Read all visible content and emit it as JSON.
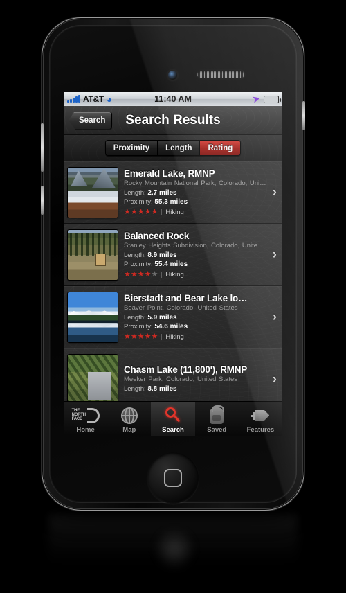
{
  "status_bar": {
    "carrier": "AT&T",
    "time": "11:40 AM",
    "signal_icon": "signal-bars-icon",
    "wifi_icon": "wifi-icon",
    "location_icon": "location-arrow-icon",
    "battery_icon": "battery-icon"
  },
  "nav": {
    "back_label": "Search",
    "title": "Search Results"
  },
  "segmented_control": {
    "options": [
      {
        "label": "Proximity",
        "selected": false
      },
      {
        "label": "Length",
        "selected": false
      },
      {
        "label": "Rating",
        "selected": true
      }
    ],
    "selected_color": "#9e1812"
  },
  "results": [
    {
      "title": "Emerald Lake, RMNP",
      "subtitle": "Rocky Mountain National Park, Colorado, Uni…",
      "length_label": "Length:",
      "length_value": "2.7 miles",
      "proximity_label": "Proximity:",
      "proximity_value": "55.3 miles",
      "rating": 5,
      "activity": "Hiking",
      "thumbnail": "emerald-lake-photo",
      "chevron": "chevron-right-icon"
    },
    {
      "title": "Balanced Rock",
      "subtitle": "Stanley Heights Subdivision, Colorado, Unite…",
      "length_label": "Length:",
      "length_value": "8.9 miles",
      "proximity_label": "Proximity:",
      "proximity_value": "55.4 miles",
      "rating": 4,
      "activity": "Hiking",
      "thumbnail": "balanced-rock-photo",
      "chevron": "chevron-right-icon"
    },
    {
      "title": "Bierstadt and Bear Lake lo…",
      "subtitle": "Beaver Point, Colorado, United States",
      "length_label": "Length:",
      "length_value": "5.9 miles",
      "proximity_label": "Proximity:",
      "proximity_value": "54.6 miles",
      "rating": 5,
      "activity": "Hiking",
      "thumbnail": "bierstadt-bear-lake-photo",
      "chevron": "chevron-right-icon"
    },
    {
      "title": "Chasm Lake (11,800'), RMNP",
      "subtitle": "Meeker Park, Colorado, United States",
      "length_label": "Length:",
      "length_value": "8.8 miles",
      "proximity_label": "",
      "proximity_value": "",
      "rating": 0,
      "activity": "",
      "thumbnail": "chasm-lake-photo",
      "chevron": "chevron-right-icon"
    }
  ],
  "tab_bar": {
    "tabs": [
      {
        "label": "Home",
        "icon": "north-face-logo-icon",
        "active": false
      },
      {
        "label": "Map",
        "icon": "globe-icon",
        "active": false
      },
      {
        "label": "Search",
        "icon": "magnifier-icon",
        "active": true
      },
      {
        "label": "Saved",
        "icon": "backpack-icon",
        "active": false
      },
      {
        "label": "Features",
        "icon": "tag-arrow-icon",
        "active": false
      }
    ],
    "active_icon_color": "#e0352b"
  },
  "device": {
    "home_button": "home-button",
    "camera": "front-camera",
    "speaker": "earpiece-speaker"
  }
}
